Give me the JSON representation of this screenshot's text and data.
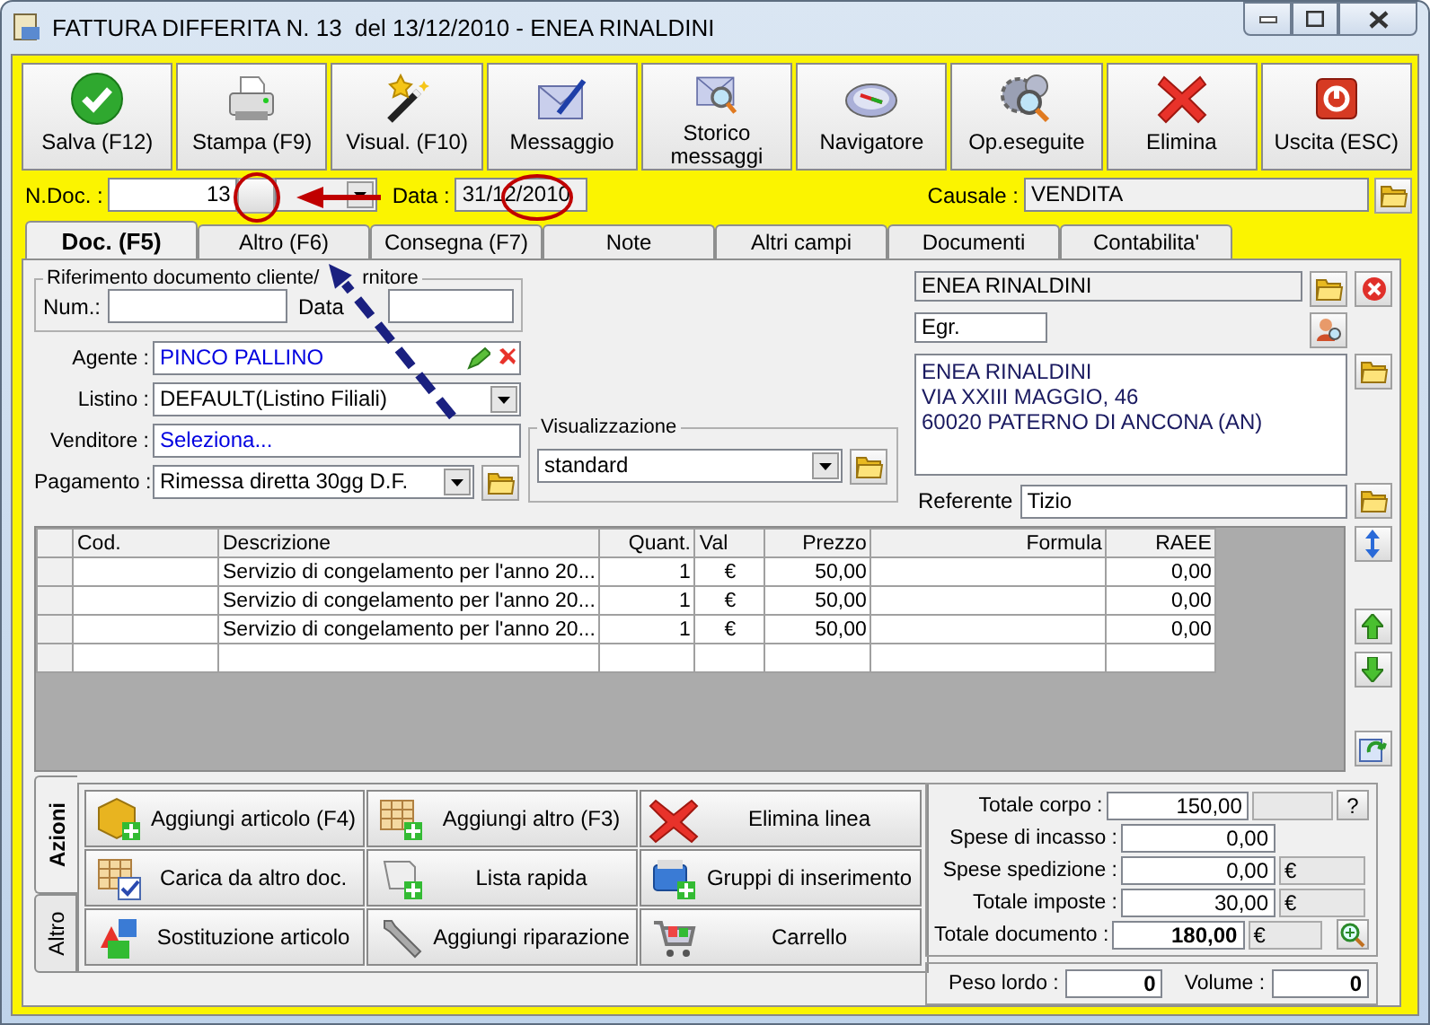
{
  "window": {
    "title": "FATTURA DIFFERITA N. 13  del 13/12/2010 - ENEA RINALDINI"
  },
  "toolbar": [
    {
      "label": "Salva (F12)"
    },
    {
      "label": "Stampa (F9)"
    },
    {
      "label": "Visual. (F10)"
    },
    {
      "label": "Messaggio"
    },
    {
      "label": "Storico messaggi"
    },
    {
      "label": "Navigatore"
    },
    {
      "label": "Op.eseguite"
    },
    {
      "label": "Elimina"
    },
    {
      "label": "Uscita (ESC)"
    }
  ],
  "header": {
    "ndoc": {
      "label": "N.Doc. :",
      "value": "13"
    },
    "data": {
      "label": "Data :",
      "value": "31/12/2010"
    },
    "causale": {
      "label": "Causale :",
      "value": "VENDITA"
    }
  },
  "tabs": [
    {
      "label": "Doc. (F5)",
      "selected": true
    },
    {
      "label": "Altro (F6)",
      "selected": false
    },
    {
      "label": "Consegna (F7)",
      "selected": false
    },
    {
      "label": "Note",
      "selected": false
    },
    {
      "label": "Altri campi",
      "selected": false
    },
    {
      "label": "Documenti",
      "selected": false
    },
    {
      "label": "Contabilita'",
      "selected": false
    }
  ],
  "riferimento": {
    "legend": "Riferimento documento cliente/",
    "legend_rest": "rnitore",
    "num_label": "Num.:",
    "data_label": "Data"
  },
  "agente": {
    "label": "Agente :",
    "value": "PINCO PALLINO"
  },
  "listino": {
    "label": "Listino :",
    "value": "DEFAULT(Listino Filiali)"
  },
  "venditore": {
    "label": "Venditore :",
    "value": "Seleziona..."
  },
  "pagamento": {
    "label": "Pagamento :",
    "value": "Rimessa diretta 30gg D.F."
  },
  "visualizzazione": {
    "legend": "Visualizzazione",
    "value": "standard"
  },
  "cliente": {
    "name": "ENEA RINALDINI",
    "title": "Egr.",
    "address": [
      "ENEA RINALDINI",
      "VIA XXIII MAGGIO, 46",
      "60020 PATERNO DI ANCONA (AN)"
    ],
    "referente": {
      "label": "Referente",
      "value": "Tizio"
    }
  },
  "table": {
    "columns": [
      "Cod.",
      "Descrizione",
      "Quant.",
      "Val",
      "Prezzo",
      "Formula",
      "RAEE"
    ],
    "rows": [
      {
        "descrizione": "Servizio di congelamento per l'anno 20...",
        "quant": "1",
        "val": "€",
        "prezzo": "50,00",
        "raee": "0,00"
      },
      {
        "descrizione": "Servizio di congelamento per l'anno 20...",
        "quant": "1",
        "val": "€",
        "prezzo": "50,00",
        "raee": "0,00"
      },
      {
        "descrizione": "Servizio di congelamento per l'anno 20...",
        "quant": "1",
        "val": "€",
        "prezzo": "50,00",
        "raee": "0,00"
      }
    ]
  },
  "side_tabs": [
    {
      "label": "Azioni",
      "selected": true
    },
    {
      "label": "Altro",
      "selected": false
    }
  ],
  "actions": [
    {
      "label": "Aggiungi articolo (F4)"
    },
    {
      "label": "Aggiungi altro (F3)"
    },
    {
      "label": "Elimina linea"
    },
    {
      "label": "Carica da altro doc."
    },
    {
      "label": "Lista rapida"
    },
    {
      "label": "Gruppi di inserimento"
    },
    {
      "label": "Sostituzione articolo"
    },
    {
      "label": "Aggiungi riparazione"
    },
    {
      "label": "Carrello"
    }
  ],
  "totals": [
    {
      "kind": "help",
      "label": "Totale corpo :",
      "value": "150,00",
      "help": "?"
    },
    {
      "kind": "plain",
      "label": "Spese di incasso :",
      "value": "0,00"
    },
    {
      "kind": "currency",
      "label": "Spese spedizione :",
      "value": "0,00",
      "currency": "€"
    },
    {
      "kind": "currency",
      "label": "Totale imposte :",
      "value": "30,00",
      "currency": "€"
    },
    {
      "kind": "total",
      "label": "Totale documento :",
      "value": "180,00",
      "currency": "€"
    }
  ],
  "weights": [
    {
      "label": "Peso lordo :",
      "value": "0"
    },
    {
      "label": "Volume :",
      "value": "0"
    }
  ]
}
